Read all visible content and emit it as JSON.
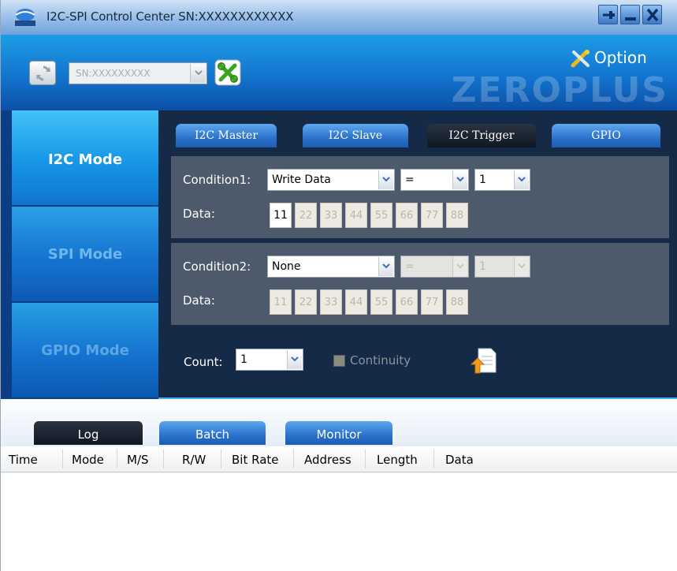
{
  "window": {
    "title": "I2C-SPI Control Center SN:XXXXXXXXXXXX"
  },
  "header": {
    "serial_select_value": "SN:XXXXXXXXX",
    "option_label": "Option",
    "brand_watermark": "ZEROPLUS"
  },
  "modes": [
    {
      "label": "I2C Mode",
      "active": true
    },
    {
      "label": "SPI Mode",
      "active": false
    },
    {
      "label": "GPIO Mode",
      "active": false
    }
  ],
  "tabs": [
    {
      "label": "I2C Master",
      "active": false
    },
    {
      "label": "I2C Slave",
      "active": false
    },
    {
      "label": "I2C Trigger",
      "active": true
    },
    {
      "label": "GPIO",
      "active": false
    }
  ],
  "condition1": {
    "label": "Condition1:",
    "type_value": "Write Data",
    "operator_value": "=",
    "count_value": "1",
    "data_label": "Data:",
    "data_bytes": [
      "11",
      "22",
      "33",
      "44",
      "55",
      "66",
      "77",
      "88"
    ],
    "enabled_bytes": 1
  },
  "condition2": {
    "label": "Condition2:",
    "type_value": "None",
    "operator_value": "=",
    "count_value": "1",
    "data_label": "Data:",
    "data_bytes": [
      "11",
      "22",
      "33",
      "44",
      "55",
      "66",
      "77",
      "88"
    ],
    "enabled_bytes": 0
  },
  "count": {
    "label": "Count:",
    "value": "1"
  },
  "continuity": {
    "label": "Continuity",
    "enabled": false
  },
  "bottom_tabs": [
    {
      "label": "Log",
      "active": true
    },
    {
      "label": "Batch",
      "active": false
    },
    {
      "label": "Monitor",
      "active": false
    }
  ],
  "log_columns": [
    "Time",
    "Mode",
    "M/S",
    "R/W",
    "Bit Rate",
    "Address",
    "Length",
    "Data"
  ],
  "colors": {
    "accent_blue": "#199ae8",
    "panel_dark": "#142a47",
    "condition_panel": "#4c5a6b"
  }
}
